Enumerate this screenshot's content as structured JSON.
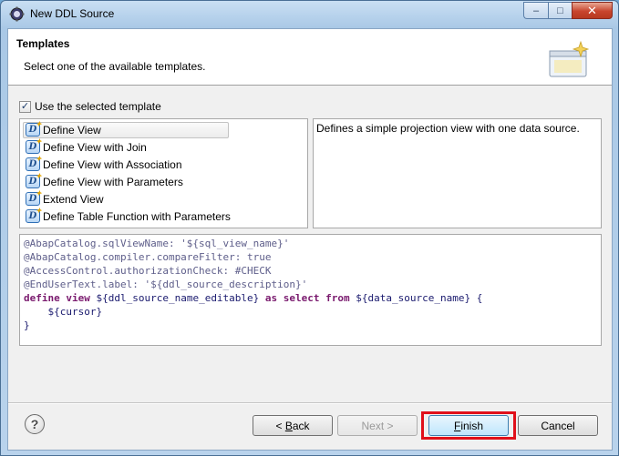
{
  "window": {
    "title": "New DDL Source",
    "controls": {
      "minimize": "–",
      "maximize": "□",
      "close": "✕"
    }
  },
  "header": {
    "title": "Templates",
    "description": "Select one of the available templates."
  },
  "use_template": {
    "label": "Use the selected template",
    "checked": true,
    "check_glyph": "✓"
  },
  "templates": [
    {
      "label": "Define View",
      "selected": true
    },
    {
      "label": "Define View with Join",
      "selected": false
    },
    {
      "label": "Define View with Association",
      "selected": false
    },
    {
      "label": "Define View with Parameters",
      "selected": false
    },
    {
      "label": "Extend View",
      "selected": false
    },
    {
      "label": "Define Table Function with Parameters",
      "selected": false
    }
  ],
  "template_icon": {
    "name": "ddl-source-icon",
    "letter": "D",
    "spark": "✦"
  },
  "description_text": "Defines a simple projection view with one data source.",
  "code_lines": [
    [
      {
        "t": "@AbapCatalog.sqlViewName: ",
        "c": "anno"
      },
      {
        "t": "'${sql_view_name}'",
        "c": "anno"
      }
    ],
    [
      {
        "t": "@AbapCatalog.compiler.compareFilter: true",
        "c": "anno"
      }
    ],
    [
      {
        "t": "@AccessControl.authorizationCheck: #CHECK",
        "c": "anno"
      }
    ],
    [
      {
        "t": "@EndUserText.label: ",
        "c": "anno"
      },
      {
        "t": "'${ddl_source_description}'",
        "c": "anno"
      }
    ],
    [
      {
        "t": "define view ",
        "c": "kw"
      },
      {
        "t": "${ddl_source_name_editable} ",
        "c": "plain"
      },
      {
        "t": "as select from ",
        "c": "kw"
      },
      {
        "t": "${data_source_name} {",
        "c": "plain"
      }
    ],
    [
      {
        "t": "    ${cursor}",
        "c": "plain"
      }
    ],
    [
      {
        "t": "}",
        "c": "plain"
      }
    ]
  ],
  "buttons": {
    "help": "?",
    "back": {
      "prefix": "< ",
      "mnemonic": "B",
      "rest": "ack"
    },
    "next": "Next >",
    "finish": {
      "mnemonic": "F",
      "rest": "inish"
    },
    "cancel": "Cancel"
  },
  "colors": {
    "highlight_frame": "#e0101a",
    "title_bar": "#b9d3ec"
  }
}
